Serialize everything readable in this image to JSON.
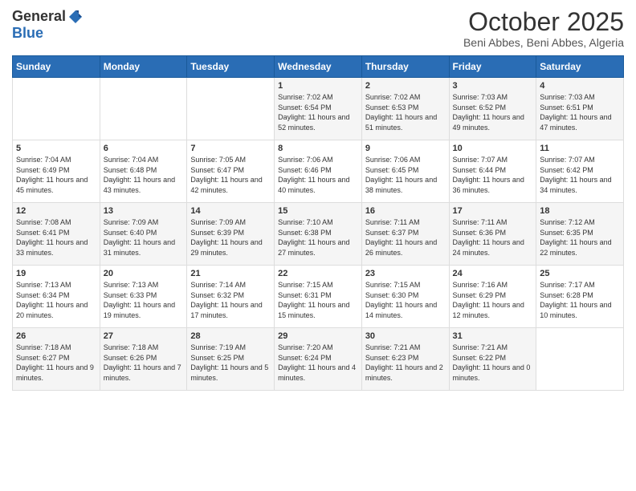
{
  "logo": {
    "general": "General",
    "blue": "Blue"
  },
  "header": {
    "month": "October 2025",
    "location": "Beni Abbes, Beni Abbes, Algeria"
  },
  "weekdays": [
    "Sunday",
    "Monday",
    "Tuesday",
    "Wednesday",
    "Thursday",
    "Friday",
    "Saturday"
  ],
  "weeks": [
    [
      {
        "day": "",
        "info": ""
      },
      {
        "day": "",
        "info": ""
      },
      {
        "day": "",
        "info": ""
      },
      {
        "day": "1",
        "info": "Sunrise: 7:02 AM\nSunset: 6:54 PM\nDaylight: 11 hours and 52 minutes."
      },
      {
        "day": "2",
        "info": "Sunrise: 7:02 AM\nSunset: 6:53 PM\nDaylight: 11 hours and 51 minutes."
      },
      {
        "day": "3",
        "info": "Sunrise: 7:03 AM\nSunset: 6:52 PM\nDaylight: 11 hours and 49 minutes."
      },
      {
        "day": "4",
        "info": "Sunrise: 7:03 AM\nSunset: 6:51 PM\nDaylight: 11 hours and 47 minutes."
      }
    ],
    [
      {
        "day": "5",
        "info": "Sunrise: 7:04 AM\nSunset: 6:49 PM\nDaylight: 11 hours and 45 minutes."
      },
      {
        "day": "6",
        "info": "Sunrise: 7:04 AM\nSunset: 6:48 PM\nDaylight: 11 hours and 43 minutes."
      },
      {
        "day": "7",
        "info": "Sunrise: 7:05 AM\nSunset: 6:47 PM\nDaylight: 11 hours and 42 minutes."
      },
      {
        "day": "8",
        "info": "Sunrise: 7:06 AM\nSunset: 6:46 PM\nDaylight: 11 hours and 40 minutes."
      },
      {
        "day": "9",
        "info": "Sunrise: 7:06 AM\nSunset: 6:45 PM\nDaylight: 11 hours and 38 minutes."
      },
      {
        "day": "10",
        "info": "Sunrise: 7:07 AM\nSunset: 6:44 PM\nDaylight: 11 hours and 36 minutes."
      },
      {
        "day": "11",
        "info": "Sunrise: 7:07 AM\nSunset: 6:42 PM\nDaylight: 11 hours and 34 minutes."
      }
    ],
    [
      {
        "day": "12",
        "info": "Sunrise: 7:08 AM\nSunset: 6:41 PM\nDaylight: 11 hours and 33 minutes."
      },
      {
        "day": "13",
        "info": "Sunrise: 7:09 AM\nSunset: 6:40 PM\nDaylight: 11 hours and 31 minutes."
      },
      {
        "day": "14",
        "info": "Sunrise: 7:09 AM\nSunset: 6:39 PM\nDaylight: 11 hours and 29 minutes."
      },
      {
        "day": "15",
        "info": "Sunrise: 7:10 AM\nSunset: 6:38 PM\nDaylight: 11 hours and 27 minutes."
      },
      {
        "day": "16",
        "info": "Sunrise: 7:11 AM\nSunset: 6:37 PM\nDaylight: 11 hours and 26 minutes."
      },
      {
        "day": "17",
        "info": "Sunrise: 7:11 AM\nSunset: 6:36 PM\nDaylight: 11 hours and 24 minutes."
      },
      {
        "day": "18",
        "info": "Sunrise: 7:12 AM\nSunset: 6:35 PM\nDaylight: 11 hours and 22 minutes."
      }
    ],
    [
      {
        "day": "19",
        "info": "Sunrise: 7:13 AM\nSunset: 6:34 PM\nDaylight: 11 hours and 20 minutes."
      },
      {
        "day": "20",
        "info": "Sunrise: 7:13 AM\nSunset: 6:33 PM\nDaylight: 11 hours and 19 minutes."
      },
      {
        "day": "21",
        "info": "Sunrise: 7:14 AM\nSunset: 6:32 PM\nDaylight: 11 hours and 17 minutes."
      },
      {
        "day": "22",
        "info": "Sunrise: 7:15 AM\nSunset: 6:31 PM\nDaylight: 11 hours and 15 minutes."
      },
      {
        "day": "23",
        "info": "Sunrise: 7:15 AM\nSunset: 6:30 PM\nDaylight: 11 hours and 14 minutes."
      },
      {
        "day": "24",
        "info": "Sunrise: 7:16 AM\nSunset: 6:29 PM\nDaylight: 11 hours and 12 minutes."
      },
      {
        "day": "25",
        "info": "Sunrise: 7:17 AM\nSunset: 6:28 PM\nDaylight: 11 hours and 10 minutes."
      }
    ],
    [
      {
        "day": "26",
        "info": "Sunrise: 7:18 AM\nSunset: 6:27 PM\nDaylight: 11 hours and 9 minutes."
      },
      {
        "day": "27",
        "info": "Sunrise: 7:18 AM\nSunset: 6:26 PM\nDaylight: 11 hours and 7 minutes."
      },
      {
        "day": "28",
        "info": "Sunrise: 7:19 AM\nSunset: 6:25 PM\nDaylight: 11 hours and 5 minutes."
      },
      {
        "day": "29",
        "info": "Sunrise: 7:20 AM\nSunset: 6:24 PM\nDaylight: 11 hours and 4 minutes."
      },
      {
        "day": "30",
        "info": "Sunrise: 7:21 AM\nSunset: 6:23 PM\nDaylight: 11 hours and 2 minutes."
      },
      {
        "day": "31",
        "info": "Sunrise: 7:21 AM\nSunset: 6:22 PM\nDaylight: 11 hours and 0 minutes."
      },
      {
        "day": "",
        "info": ""
      }
    ]
  ]
}
